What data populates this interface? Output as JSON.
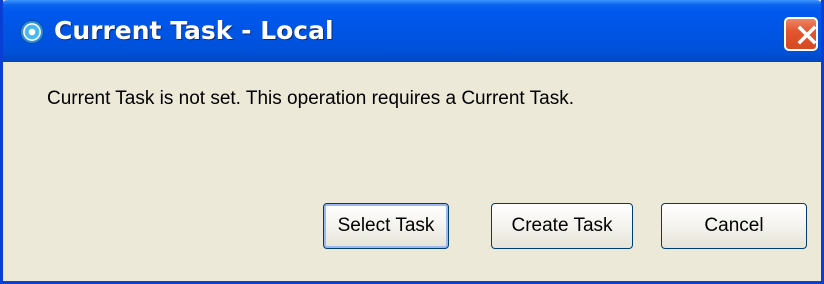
{
  "window": {
    "title": "Current Task - Local",
    "icon": "app-icon",
    "close_icon": "close-icon"
  },
  "dialog": {
    "message": "Current Task is not set. This operation requires a Current Task."
  },
  "buttons": {
    "select_task": "Select Task",
    "create_task": "Create Task",
    "cancel": "Cancel"
  },
  "colors": {
    "titlebar": "#0055e5",
    "background": "#ece9d8",
    "close_button": "#e2572f"
  }
}
